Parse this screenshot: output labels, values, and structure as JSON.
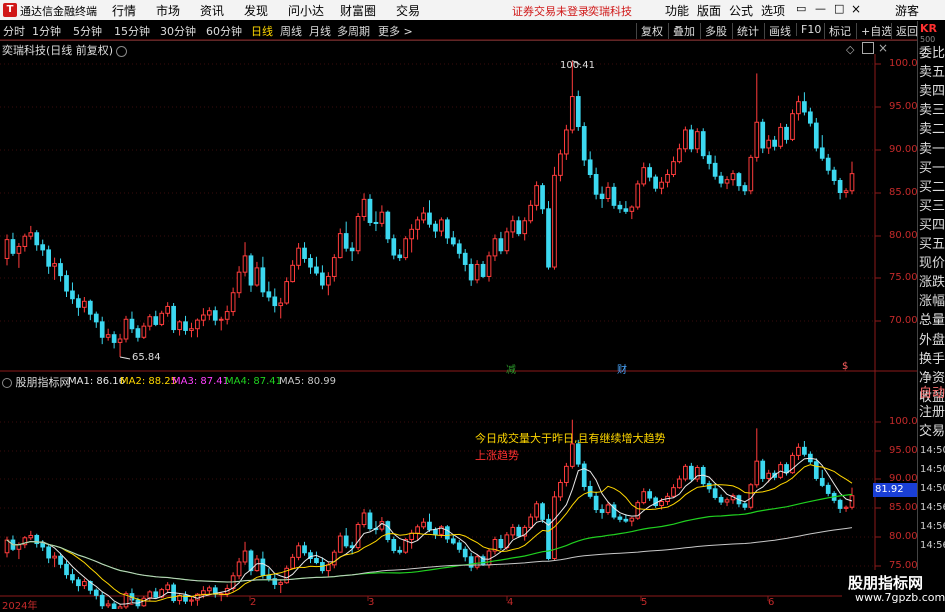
{
  "titlebar": {
    "logo": "T",
    "app_title": "通达信金融终端",
    "menus": [
      "行情",
      "市场",
      "资讯",
      "发现",
      "问小达",
      "财富圈",
      "交易"
    ],
    "notice": "证券交易未登录",
    "stock_name_bar": "奕瑞科技",
    "right_menus": [
      "功能",
      "版面",
      "公式",
      "选项"
    ],
    "guest": "游客",
    "win_icons": [
      "▭",
      "—",
      "□",
      "×"
    ]
  },
  "toolbar": {
    "periods": [
      "分时",
      "1分钟",
      "5分钟",
      "15分钟",
      "30分钟",
      "60分钟",
      "日线",
      "周线",
      "月线",
      "多周期",
      "更多 >"
    ],
    "active_period": "日线",
    "tools": [
      "复权",
      "叠加",
      "多股",
      "统计",
      "画线",
      "F10",
      "标记",
      "+自选",
      "返回"
    ]
  },
  "stock": {
    "title": "奕瑞科技(日线 前复权)",
    "high_label": "100.41",
    "low_label": "65.84"
  },
  "price_axis": [
    "100.0",
    "95.00",
    "90.00",
    "85.00",
    "80.00",
    "75.00",
    "70.00"
  ],
  "indicator_axis": [
    "100.0",
    "95.00",
    "90.00",
    "85.00",
    "80.00",
    "75.00"
  ],
  "last_price_tag": "81.92",
  "indicator": {
    "name": "股朋指标网",
    "ma": [
      {
        "label": "MA1: 86.16",
        "color": "#e8e8e8"
      },
      {
        "label": "MA2: 88.25",
        "color": "#ffd700"
      },
      {
        "label": "MA3: 87.41",
        "color": "#ff40ff"
      },
      {
        "label": "MA4: 87.41",
        "color": "#20d020"
      },
      {
        "label": "MA5: 80.99",
        "color": "#c8c8c8"
      }
    ],
    "note1": "今日成交量大于昨日,且有继续增大趋势",
    "note2": "上涨趋势"
  },
  "markers": [
    {
      "text": "减",
      "color": "#2c9c2c"
    },
    {
      "text": "财",
      "color": "#4aa8ff"
    },
    {
      "text": "$",
      "color": "#ff6060"
    }
  ],
  "date_axis": {
    "year": "2024年",
    "months": [
      "1",
      "2",
      "3",
      "4",
      "5",
      "6"
    ]
  },
  "sidebar": {
    "top": "KR",
    "top_sub": "500",
    "items": [
      "委比",
      "卖五",
      "卖四",
      "卖三",
      "卖二",
      "卖一",
      "买一",
      "买二",
      "买三",
      "买四",
      "买五",
      "现价",
      "涨跌",
      "涨幅",
      "总量",
      "外盘",
      "换手",
      "净资",
      "收益",
      "自动",
      "注册",
      "交易"
    ],
    "time_labels": [
      "14:50",
      "14:50",
      "14:50",
      "14:56",
      "14:56",
      "14:56"
    ]
  },
  "watermark": {
    "line1": "股朋指标网",
    "line2": "www.7gpzb.com"
  },
  "chart_data": {
    "type": "candlestick",
    "price_range": [
      66,
      102
    ],
    "candles": [
      [
        77.3,
        80.1,
        76.5,
        79.5
      ],
      [
        79.5,
        80.3,
        77.6,
        77.9
      ],
      [
        77.9,
        79.1,
        76.2,
        78.7
      ],
      [
        78.7,
        80.2,
        78.1,
        79.9
      ],
      [
        79.9,
        81.1,
        79.5,
        80.3
      ],
      [
        80.3,
        80.6,
        78.2,
        78.9
      ],
      [
        78.9,
        79.5,
        77.6,
        78.3
      ],
      [
        78.3,
        78.8,
        75.5,
        76.4
      ],
      [
        76.4,
        77.4,
        74.8,
        76.7
      ],
      [
        76.7,
        77.3,
        74.6,
        75.3
      ],
      [
        75.3,
        75.9,
        72.8,
        73.5
      ],
      [
        73.5,
        74.5,
        72.0,
        72.6
      ],
      [
        72.6,
        73.1,
        70.6,
        71.6
      ],
      [
        71.6,
        72.8,
        71.0,
        72.3
      ],
      [
        72.3,
        72.5,
        70.1,
        70.8
      ],
      [
        70.8,
        71.1,
        69.2,
        69.9
      ],
      [
        69.9,
        70.5,
        67.3,
        68.1
      ],
      [
        68.1,
        69.1,
        67.7,
        68.4
      ],
      [
        68.4,
        68.8,
        66.8,
        67.5
      ],
      [
        67.5,
        68.5,
        65.8,
        67.9
      ],
      [
        67.9,
        70.6,
        67.5,
        70.2
      ],
      [
        70.2,
        71.1,
        68.6,
        69.1
      ],
      [
        69.1,
        69.5,
        67.6,
        68.1
      ],
      [
        68.1,
        69.8,
        67.9,
        69.4
      ],
      [
        69.4,
        70.8,
        68.9,
        70.5
      ],
      [
        70.5,
        71.2,
        69.4,
        69.6
      ],
      [
        69.6,
        71.2,
        69.4,
        70.9
      ],
      [
        70.9,
        72.2,
        70.5,
        71.7
      ],
      [
        71.7,
        72.1,
        68.6,
        69.0
      ],
      [
        69.0,
        70.1,
        68.3,
        69.9
      ],
      [
        69.9,
        70.6,
        68.4,
        68.9
      ],
      [
        68.9,
        69.8,
        68.1,
        69.1
      ],
      [
        69.1,
        70.3,
        68.1,
        70.1
      ],
      [
        70.1,
        71.5,
        69.4,
        70.7
      ],
      [
        70.7,
        71.6,
        70.1,
        71.2
      ],
      [
        71.2,
        71.7,
        69.5,
        70.1
      ],
      [
        70.1,
        70.5,
        68.9,
        70.2
      ],
      [
        70.2,
        71.8,
        69.6,
        71.1
      ],
      [
        71.1,
        73.9,
        70.6,
        73.3
      ],
      [
        73.3,
        76.4,
        72.7,
        75.7
      ],
      [
        75.7,
        79.2,
        75.2,
        77.6
      ],
      [
        77.6,
        77.9,
        73.4,
        74.2
      ],
      [
        74.2,
        76.9,
        74.0,
        76.2
      ],
      [
        76.2,
        77.5,
        72.8,
        73.4
      ],
      [
        73.4,
        74.6,
        72.3,
        72.8
      ],
      [
        72.8,
        73.8,
        71.0,
        71.8
      ],
      [
        71.8,
        72.7,
        70.3,
        72.1
      ],
      [
        72.1,
        75.1,
        71.9,
        74.6
      ],
      [
        74.6,
        77.1,
        74.5,
        76.5
      ],
      [
        76.5,
        79.1,
        76.0,
        78.5
      ],
      [
        78.5,
        79.2,
        76.8,
        77.3
      ],
      [
        77.3,
        77.8,
        75.5,
        76.3
      ],
      [
        76.3,
        77.5,
        75.3,
        75.6
      ],
      [
        75.6,
        76.5,
        73.7,
        74.2
      ],
      [
        74.2,
        75.7,
        73.0,
        75.2
      ],
      [
        75.2,
        77.8,
        74.6,
        77.4
      ],
      [
        77.4,
        80.8,
        77.3,
        80.2
      ],
      [
        80.2,
        81.6,
        78.1,
        78.5
      ],
      [
        78.5,
        79.2,
        77.0,
        78.2
      ],
      [
        78.2,
        82.6,
        77.8,
        82.2
      ],
      [
        82.2,
        84.9,
        81.7,
        84.2
      ],
      [
        84.2,
        84.8,
        81.1,
        81.5
      ],
      [
        81.5,
        82.8,
        80.5,
        81.4
      ],
      [
        81.4,
        83.5,
        81.0,
        82.7
      ],
      [
        82.7,
        82.9,
        79.1,
        79.6
      ],
      [
        79.6,
        80.1,
        77.2,
        77.7
      ],
      [
        77.7,
        78.4,
        77.0,
        77.4
      ],
      [
        77.4,
        79.9,
        77.1,
        79.6
      ],
      [
        79.6,
        81.3,
        78.0,
        80.7
      ],
      [
        80.7,
        82.2,
        79.5,
        81.8
      ],
      [
        81.8,
        83.3,
        81.4,
        82.6
      ],
      [
        82.6,
        84.1,
        80.9,
        81.3
      ],
      [
        81.3,
        81.7,
        79.7,
        80.5
      ],
      [
        80.5,
        82.1,
        79.9,
        81.8
      ],
      [
        81.8,
        82.1,
        79.0,
        79.7
      ],
      [
        79.7,
        80.5,
        78.7,
        79.0
      ],
      [
        79.0,
        79.5,
        77.3,
        77.9
      ],
      [
        77.9,
        78.4,
        75.8,
        76.6
      ],
      [
        76.6,
        77.3,
        74.1,
        74.8
      ],
      [
        74.8,
        77.1,
        74.4,
        76.6
      ],
      [
        76.6,
        77.0,
        75.0,
        75.2
      ],
      [
        75.2,
        78.1,
        74.6,
        77.6
      ],
      [
        77.6,
        80.1,
        77.0,
        79.6
      ],
      [
        79.6,
        80.4,
        77.8,
        78.2
      ],
      [
        78.2,
        80.9,
        77.8,
        80.4
      ],
      [
        80.4,
        82.3,
        79.7,
        81.7
      ],
      [
        81.7,
        82.2,
        79.9,
        80.2
      ],
      [
        80.2,
        82.1,
        79.4,
        81.7
      ],
      [
        81.7,
        84.1,
        81.4,
        83.5
      ],
      [
        83.5,
        86.3,
        82.9,
        85.8
      ],
      [
        85.8,
        86.1,
        82.5,
        83.1
      ],
      [
        83.1,
        84.0,
        76.0,
        76.3
      ],
      [
        76.3,
        88.0,
        76.0,
        87.0
      ],
      [
        87.0,
        90.0,
        86.3,
        89.5
      ],
      [
        89.5,
        92.9,
        88.8,
        92.3
      ],
      [
        92.3,
        100.4,
        91.9,
        96.2
      ],
      [
        96.2,
        96.9,
        92.2,
        92.7
      ],
      [
        92.7,
        93.2,
        88.1,
        88.8
      ],
      [
        88.8,
        89.8,
        86.7,
        87.1
      ],
      [
        87.1,
        87.9,
        84.2,
        84.8
      ],
      [
        84.8,
        85.7,
        83.2,
        84.3
      ],
      [
        84.3,
        86.2,
        83.9,
        85.6
      ],
      [
        85.6,
        86.1,
        83.1,
        83.5
      ],
      [
        83.5,
        84.0,
        82.6,
        83.1
      ],
      [
        83.1,
        84.0,
        82.5,
        82.8
      ],
      [
        82.8,
        83.5,
        81.9,
        83.3
      ],
      [
        83.3,
        86.4,
        83.0,
        86.0
      ],
      [
        86.0,
        88.5,
        85.7,
        87.9
      ],
      [
        87.9,
        88.4,
        86.3,
        86.8
      ],
      [
        86.8,
        87.1,
        85.1,
        85.5
      ],
      [
        85.5,
        86.8,
        84.8,
        86.2
      ],
      [
        86.2,
        87.7,
        85.6,
        87.1
      ],
      [
        87.1,
        89.2,
        86.8,
        88.6
      ],
      [
        88.6,
        90.7,
        88.4,
        90.1
      ],
      [
        90.1,
        92.7,
        89.7,
        92.3
      ],
      [
        92.3,
        92.9,
        89.7,
        90.1
      ],
      [
        90.1,
        92.5,
        89.6,
        92.1
      ],
      [
        92.1,
        92.5,
        88.9,
        89.3
      ],
      [
        89.3,
        89.8,
        87.7,
        88.4
      ],
      [
        88.4,
        89.3,
        86.5,
        86.9
      ],
      [
        86.9,
        87.4,
        85.6,
        86.1
      ],
      [
        86.1,
        86.9,
        85.4,
        86.5
      ],
      [
        86.5,
        87.6,
        85.8,
        87.2
      ],
      [
        87.2,
        87.4,
        85.2,
        85.8
      ],
      [
        85.8,
        86.2,
        84.7,
        85.2
      ],
      [
        85.2,
        89.4,
        84.8,
        89.1
      ],
      [
        89.1,
        98.9,
        88.6,
        93.2
      ],
      [
        93.2,
        93.6,
        89.6,
        90.2
      ],
      [
        90.2,
        91.7,
        89.5,
        91.1
      ],
      [
        91.1,
        91.6,
        89.9,
        90.4
      ],
      [
        90.4,
        93.1,
        90.1,
        92.6
      ],
      [
        92.6,
        93.0,
        90.7,
        91.2
      ],
      [
        91.2,
        94.7,
        91.0,
        94.2
      ],
      [
        94.2,
        96.3,
        93.4,
        95.6
      ],
      [
        95.6,
        96.7,
        94.0,
        94.4
      ],
      [
        94.4,
        94.9,
        92.7,
        93.1
      ],
      [
        93.1,
        93.7,
        89.8,
        90.2
      ],
      [
        90.2,
        91.7,
        88.7,
        89.0
      ],
      [
        89.0,
        89.5,
        87.1,
        87.6
      ],
      [
        87.6,
        88.0,
        85.9,
        86.4
      ],
      [
        86.4,
        86.7,
        84.2,
        85.0
      ],
      [
        85.0,
        85.5,
        84.4,
        85.2
      ],
      [
        85.2,
        88.6,
        84.8,
        87.2
      ]
    ],
    "moving_averages": {
      "MA1_last": 86.16,
      "MA2_last": 88.25,
      "MA3_last": 87.41,
      "MA4_last": 87.41,
      "MA5_last": 80.99
    }
  }
}
